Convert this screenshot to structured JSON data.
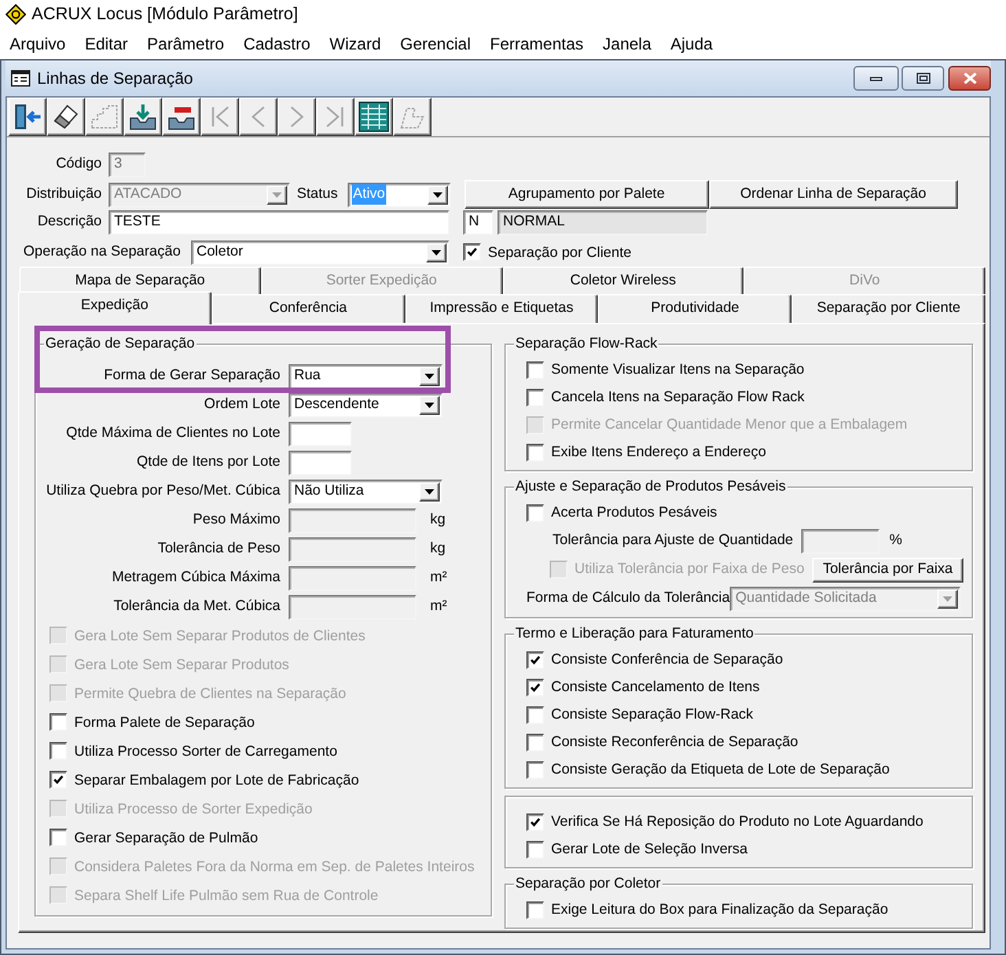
{
  "app": {
    "title": "ACRUX Locus [Módulo Parâmetro]"
  },
  "menu": [
    "Arquivo",
    "Editar",
    "Parâmetro",
    "Cadastro",
    "Wizard",
    "Gerencial",
    "Ferramentas",
    "Janela",
    "Ajuda"
  ],
  "window": {
    "title": "Linhas de Separação"
  },
  "toolbar": [
    {
      "kind": "exit",
      "disabled": false
    },
    {
      "kind": "eraser",
      "disabled": false
    },
    {
      "kind": "edit",
      "disabled": true
    },
    {
      "kind": "save",
      "disabled": false
    },
    {
      "kind": "delete",
      "disabled": false
    },
    {
      "kind": "first",
      "disabled": true
    },
    {
      "kind": "previous",
      "disabled": true
    },
    {
      "kind": "next",
      "disabled": true
    },
    {
      "kind": "last",
      "disabled": true
    },
    {
      "kind": "grid",
      "disabled": false
    },
    {
      "kind": "wizard",
      "disabled": true
    }
  ],
  "header": {
    "code": {
      "label": "Código",
      "value": "3",
      "disabled": true
    },
    "distribution": {
      "label": "Distribuição",
      "value": "ATACADO",
      "disabled": true
    },
    "status": {
      "label": "Status",
      "value": "Ativo",
      "focused": true
    },
    "buttons": [
      "Agrupamento por Palete",
      "Ordenar Linha de Separação"
    ],
    "description": {
      "label": "Descrição",
      "value": "TESTE"
    },
    "type": {
      "code": "N",
      "name": "NORMAL"
    },
    "operation": {
      "label": "Operação na Separação",
      "value": "Coletor"
    },
    "by_client": {
      "label": "Separação por Cliente",
      "checked": true
    }
  },
  "tab_rows": [
    {
      "tabs": [
        {
          "label": "Mapa de Separação",
          "selected": false,
          "disabled": false
        },
        {
          "label": "Sorter Expedição",
          "selected": false,
          "disabled": true
        },
        {
          "label": "Coletor Wireless",
          "selected": false,
          "disabled": false
        },
        {
          "label": "DiVo",
          "selected": false,
          "disabled": true
        }
      ]
    },
    {
      "tabs": [
        {
          "label": "Expedição",
          "selected": true,
          "disabled": false
        },
        {
          "label": "Conferência",
          "selected": false,
          "disabled": false
        },
        {
          "label": "Impressão e Etiquetas",
          "selected": false,
          "disabled": false
        },
        {
          "label": "Produtividade",
          "selected": false,
          "disabled": false
        },
        {
          "label": "Separação por Cliente",
          "selected": false,
          "disabled": false
        }
      ]
    }
  ],
  "left_group": {
    "title": "Geração de Separação",
    "fields": [
      {
        "kind": "combo",
        "label": "Forma de Gerar Separação",
        "value": "Rua",
        "disabled": false,
        "highlighted": true
      },
      {
        "kind": "combo",
        "label": "Ordem Lote",
        "value": "Descendente",
        "disabled": false,
        "highlighted": false
      },
      {
        "kind": "input",
        "label": "Qtde Máxima de Clientes no Lote",
        "disabled": false,
        "highlighted": false
      },
      {
        "kind": "input",
        "label": "Qtde de Itens por Lote",
        "disabled": false,
        "highlighted": false
      },
      {
        "kind": "combo",
        "label": "Utiliza Quebra por Peso/Met. Cúbica",
        "value": "Não Utiliza",
        "disabled": false,
        "highlighted": false
      },
      {
        "kind": "input",
        "label": "Peso Máximo",
        "unit": "kg",
        "disabled": true,
        "highlighted": false
      },
      {
        "kind": "input",
        "label": "Tolerância de Peso",
        "unit": "kg",
        "disabled": true,
        "highlighted": false
      },
      {
        "kind": "input",
        "label": "Metragem Cúbica Máxima",
        "unit": "m²",
        "disabled": true,
        "highlighted": false
      },
      {
        "kind": "input",
        "label": "Tolerância da Met. Cúbica",
        "unit": "m²",
        "disabled": true,
        "highlighted": false
      }
    ],
    "checkboxes": [
      {
        "label": "Gera Lote Sem Separar Produtos de Clientes",
        "checked": false,
        "disabled": true
      },
      {
        "label": "Gera Lote Sem Separar Produtos",
        "checked": false,
        "disabled": true
      },
      {
        "label": "Permite Quebra de Clientes na Separação",
        "checked": false,
        "disabled": true
      },
      {
        "label": "Forma Palete de Separação",
        "checked": false,
        "disabled": false
      },
      {
        "label": "Utiliza Processo Sorter de Carregamento",
        "checked": false,
        "disabled": false
      },
      {
        "label": "Separar Embalagem por Lote de Fabricação",
        "checked": true,
        "disabled": false
      },
      {
        "label": "Utiliza Processo de Sorter Expedição",
        "checked": false,
        "disabled": true
      },
      {
        "label": "Gerar Separação de Pulmão",
        "checked": false,
        "disabled": false
      },
      {
        "label": "Considera Paletes Fora da Norma em Sep. de Paletes Inteiros",
        "checked": false,
        "disabled": true
      },
      {
        "label": "Separa Shelf Life Pulmão sem Rua de Controle",
        "checked": false,
        "disabled": true
      }
    ]
  },
  "right_groups": [
    {
      "title": "Separação Flow-Rack",
      "items": [
        {
          "kind": "checkbox",
          "label": "Somente Visualizar Itens na Separação",
          "checked": false,
          "disabled": false
        },
        {
          "kind": "checkbox",
          "label": "Cancela Itens na Separação Flow Rack",
          "checked": false,
          "disabled": false
        },
        {
          "kind": "checkbox",
          "label": "Permite Cancelar Quantidade Menor que a Embalagem",
          "checked": false,
          "disabled": true
        },
        {
          "kind": "checkbox",
          "label": "Exibe Itens Endereço a Endereço",
          "checked": false,
          "disabled": false
        }
      ]
    },
    {
      "title": "Ajuste e Separação de Produtos Pesáveis",
      "items": [
        {
          "kind": "checkbox",
          "label": "Acerta Produtos Pesáveis",
          "checked": false,
          "disabled": false
        },
        {
          "kind": "input",
          "label": "Tolerância para Ajuste de Quantidade",
          "unit": "%",
          "disabled": true
        },
        {
          "kind": "checkbox_button",
          "label": "Utiliza Tolerância por Faixa de Peso",
          "checked": false,
          "disabled": true,
          "button": "Tolerância por Faixa"
        },
        {
          "kind": "combo",
          "label": "Forma de Cálculo da Tolerância",
          "value": "Quantidade Solicitada",
          "disabled": true
        }
      ]
    },
    {
      "title": "Termo e Liberação para Faturamento",
      "items": [
        {
          "kind": "checkbox",
          "label": "Consiste Conferência de Separação",
          "checked": true,
          "disabled": false
        },
        {
          "kind": "checkbox",
          "label": "Consiste Cancelamento de Itens",
          "checked": true,
          "disabled": false
        },
        {
          "kind": "checkbox",
          "label": "Consiste Separação Flow-Rack",
          "checked": false,
          "disabled": false
        },
        {
          "kind": "checkbox",
          "label": "Consiste Reconferência de Separação",
          "checked": false,
          "disabled": false
        },
        {
          "kind": "checkbox",
          "label": "Consiste Geração da Etiqueta de Lote de Separação",
          "checked": false,
          "disabled": false
        }
      ]
    },
    {
      "items": [
        {
          "kind": "checkbox",
          "label": "Verifica Se Há Reposição do Produto no Lote Aguardando",
          "checked": true,
          "disabled": false
        },
        {
          "kind": "checkbox",
          "label": "Gerar Lote de Seleção Inversa",
          "checked": false,
          "disabled": false
        }
      ]
    },
    {
      "title": "Separação por Coletor",
      "items": [
        {
          "kind": "checkbox",
          "label": "Exige Leitura do Box para Finalização da Separação",
          "checked": false,
          "disabled": false
        }
      ]
    }
  ]
}
